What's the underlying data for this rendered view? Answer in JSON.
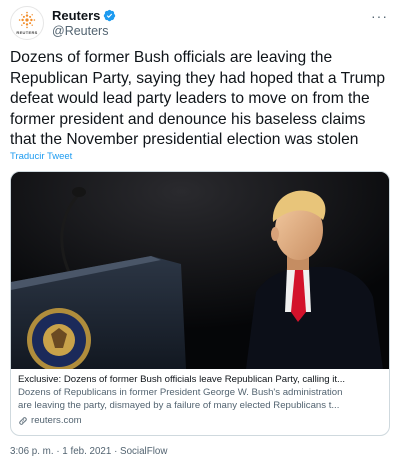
{
  "account": {
    "display_name": "Reuters",
    "handle": "@Reuters",
    "avatar_text": "REUTERS",
    "verified_icon": "verified-badge-icon",
    "more_label": "···"
  },
  "tweet": {
    "lines": [
      "Dozens of former Bush officials are leaving the",
      "Republican Party, saying they had hoped that a Trump",
      "defeat would lead party leaders to move on from the",
      "former president and denounce his baseless claims",
      "that the November presidential election was stolen"
    ],
    "translate_label": "Traducir Tweet"
  },
  "card": {
    "title": "Exclusive: Dozens of former Bush officials leave Republican Party, calling it...",
    "description_lines": [
      "Dozens of Republicans in former President George W. Bush's administration",
      "are leaving the party, dismayed by a failure of many elected Republicans t..."
    ],
    "domain": "reuters.com",
    "domain_icon": "link-icon"
  },
  "footer": {
    "time": "3:06 p. m.",
    "separator": "·",
    "date": "1 feb. 2021",
    "source": "SocialFlow"
  },
  "colors": {
    "link_blue": "#1d9bf0",
    "secondary_text": "#536471",
    "card_border": "#cfd9de",
    "reuters_orange": "#f28c28"
  }
}
